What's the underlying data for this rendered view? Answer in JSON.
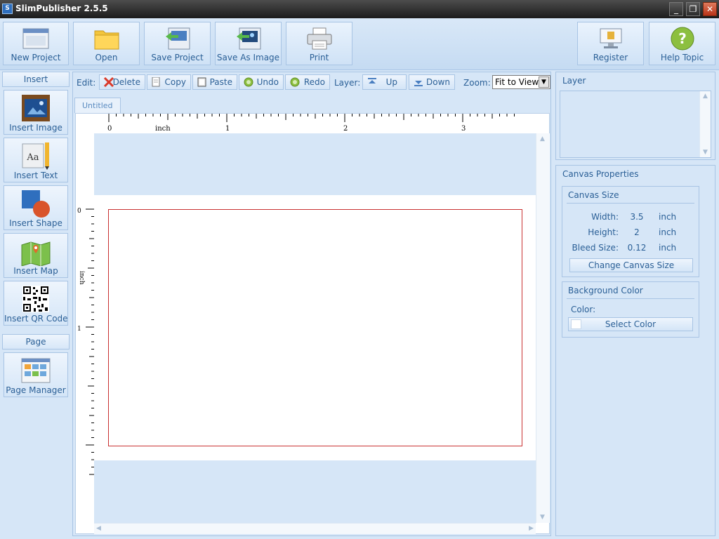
{
  "window": {
    "title": "SlimPublisher 2.5.5",
    "minimize": "_",
    "restore": "❐",
    "close": "✕"
  },
  "toolbar": {
    "new_project": "New Project",
    "open": "Open",
    "save_project": "Save Project",
    "save_as_image": "Save As Image",
    "print": "Print",
    "register": "Register",
    "help_topic": "Help Topic"
  },
  "insert_panel": {
    "header": "Insert",
    "items": [
      "Insert Image",
      "Insert Text",
      "Insert Shape",
      "Insert Map",
      "Insert QR Code"
    ]
  },
  "page_panel": {
    "header": "Page",
    "page_manager": "Page Manager"
  },
  "editbar": {
    "edit_label": "Edit:",
    "delete": "Delete",
    "copy": "Copy",
    "paste": "Paste",
    "undo": "Undo",
    "redo": "Redo",
    "layer_label": "Layer:",
    "up": "Up",
    "down": "Down",
    "zoom_label": "Zoom:",
    "zoom_value": "Fit to View"
  },
  "document": {
    "tab": "Untitled",
    "ruler_unit": "inch",
    "ruler_marks": [
      "0",
      "1",
      "2",
      "3"
    ],
    "vruler_marks": [
      "0",
      "1"
    ]
  },
  "layer_panel": {
    "title": "Layer"
  },
  "canvas_properties": {
    "title": "Canvas Properties",
    "canvas_size": {
      "title": "Canvas Size",
      "width_label": "Width:",
      "width": "3.5",
      "height_label": "Height:",
      "height": "2",
      "bleed_label": "Bleed Size:",
      "bleed": "0.12",
      "unit": "inch",
      "change_button": "Change Canvas Size"
    },
    "background": {
      "title": "Background Color",
      "color_label": "Color:",
      "select_button": "Select Color"
    }
  }
}
